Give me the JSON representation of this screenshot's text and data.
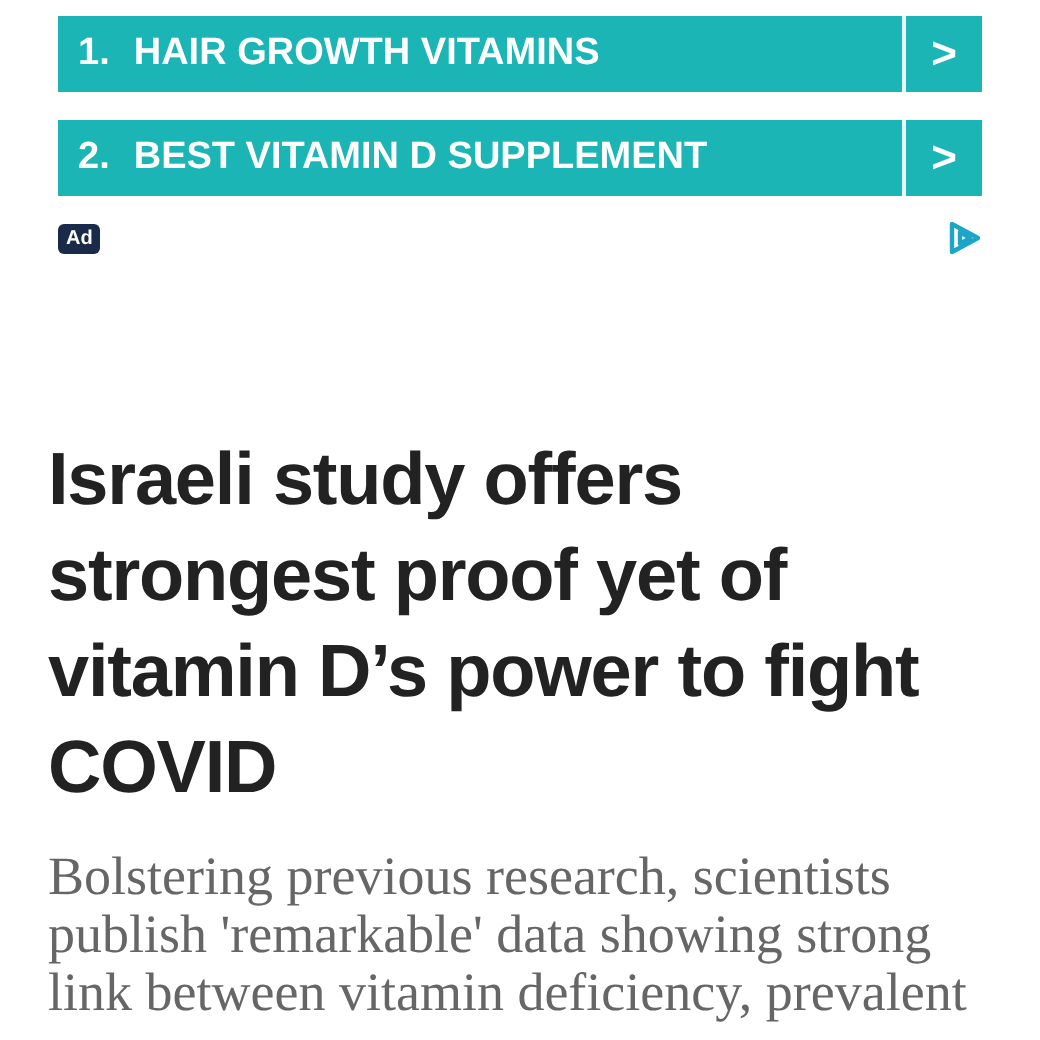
{
  "ads": [
    {
      "number": "1.",
      "label": "HAIR GROWTH VITAMINS",
      "arrow": ">"
    },
    {
      "number": "2.",
      "label": "BEST VITAMIN D SUPPLEMENT",
      "arrow": ">"
    }
  ],
  "ad_badge": "Ad",
  "headline": "Israeli study offers strongest proof yet of vitamin D’s power to fight COVID",
  "subheadline": "Bolstering previous research, scientists publish 'remarkable' data showing strong link between vitamin deficiency, prevalent"
}
